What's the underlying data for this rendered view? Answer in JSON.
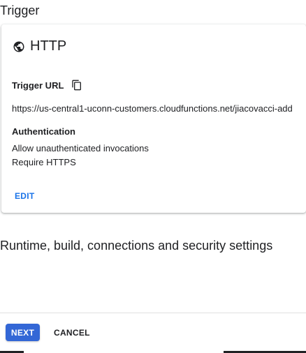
{
  "trigger_section": {
    "title": "Trigger",
    "card": {
      "type_icon": "globe-icon",
      "type_label": "HTTP",
      "url_label": "Trigger URL",
      "copy_icon": "copy-icon",
      "url": "https://us-central1-uconn-customers.cloudfunctions.net/jiacovacci-add",
      "auth_label": "Authentication",
      "auth_lines": [
        "Allow unauthenticated invocations",
        "Require HTTPS"
      ],
      "edit_label": "EDIT"
    }
  },
  "runtime_section": {
    "title": "Runtime, build, connections and security settings"
  },
  "footer": {
    "next_label": "NEXT",
    "cancel_label": "CANCEL"
  },
  "colors": {
    "accent": "#1a73e8",
    "primary_button": "#3367d6",
    "text": "#202124"
  }
}
